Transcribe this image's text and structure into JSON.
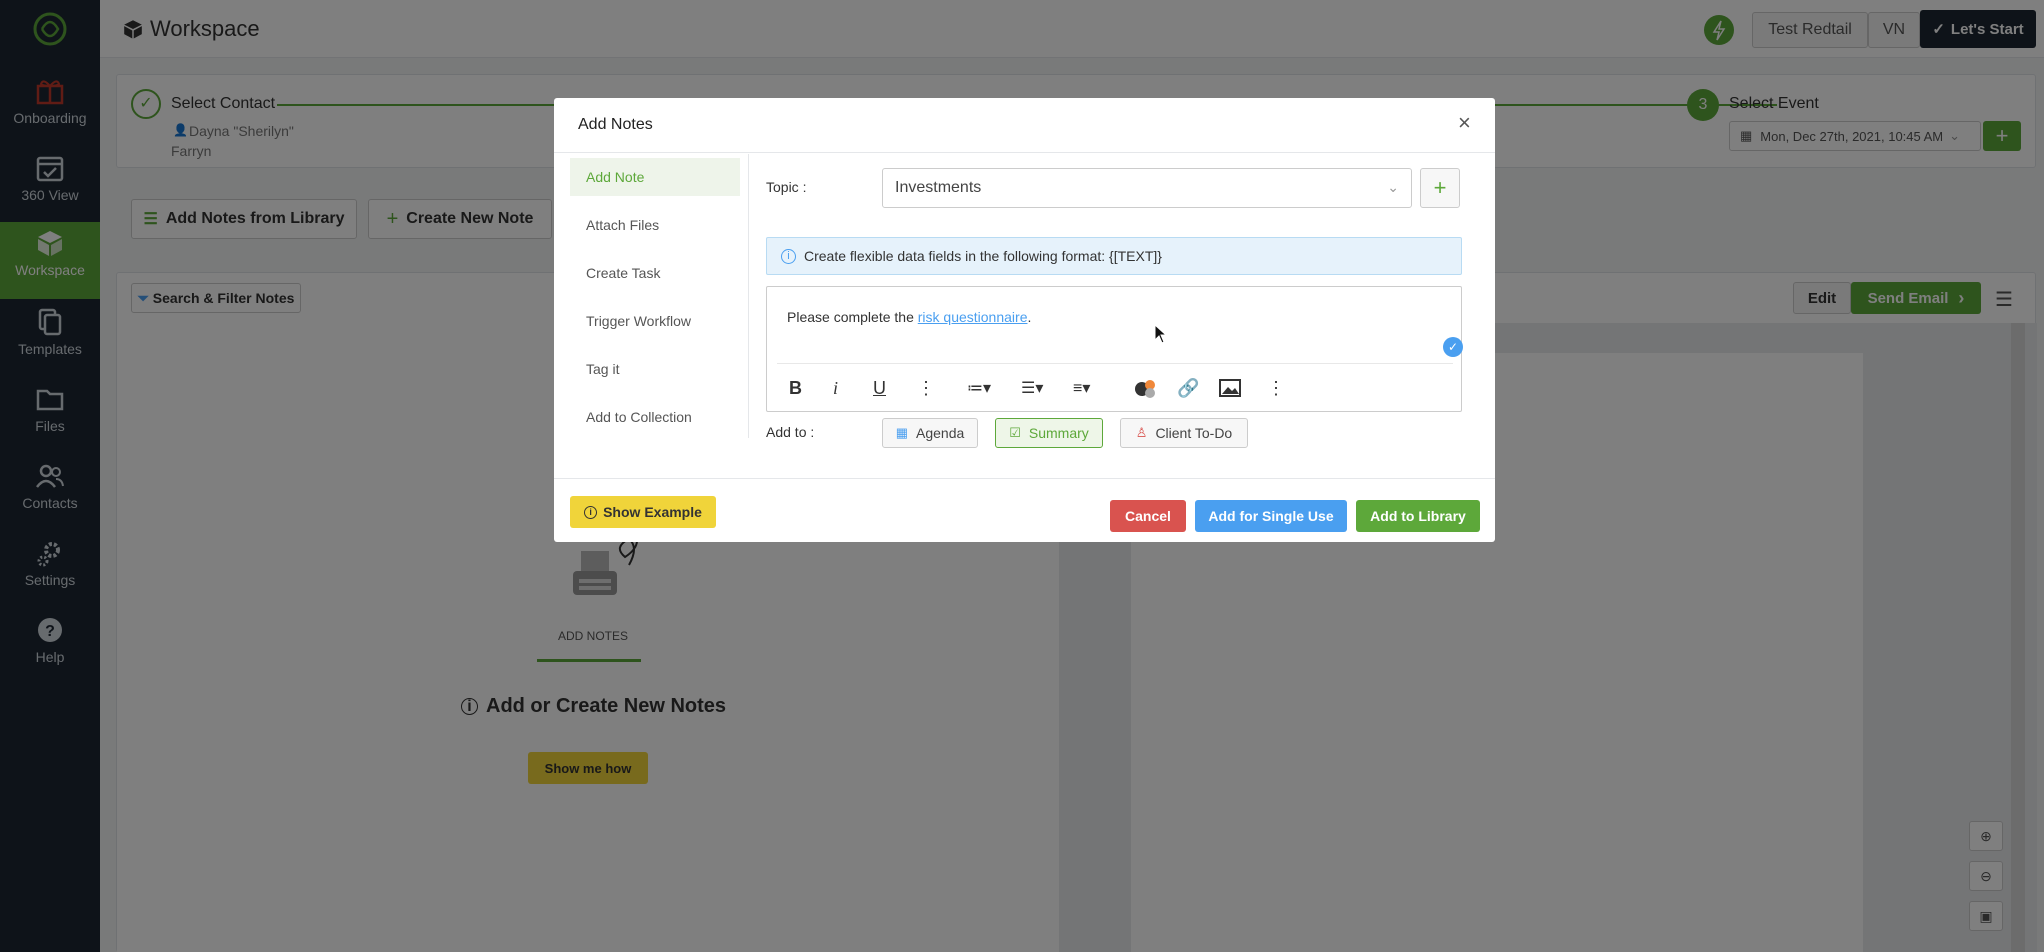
{
  "app": {
    "title": "Workspace"
  },
  "sidebar": {
    "items": [
      {
        "label": "Onboarding",
        "icon": "gift-icon"
      },
      {
        "label": "360 View",
        "icon": "calendar-check-icon"
      },
      {
        "label": "Workspace",
        "icon": "cube-icon"
      },
      {
        "label": "Templates",
        "icon": "documents-icon"
      },
      {
        "label": "Files",
        "icon": "folder-icon"
      },
      {
        "label": "Contacts",
        "icon": "users-icon"
      },
      {
        "label": "Settings",
        "icon": "gears-icon"
      },
      {
        "label": "Help",
        "icon": "help-circle-icon"
      }
    ]
  },
  "header": {
    "account": "Test Redtail",
    "initials": "VN",
    "start_label": "Let's Start"
  },
  "steps": {
    "contact_title": "Select Contact",
    "contact_name_line1": "Dayna \"Sherilyn\"",
    "contact_name_line2": "Farryn",
    "event_number": "3",
    "event_title": "Select Event",
    "event_date": "Mon, Dec 27th, 2021, 10:45 AM"
  },
  "toolbar": {
    "add_from_library": "Add Notes from Library",
    "create_new": "Create New Note",
    "search_filter": "Search & Filter Notes",
    "edit": "Edit",
    "send_email": "Send Email"
  },
  "empty": {
    "caption": "ADD NOTES",
    "title": "Add or Create New Notes",
    "show_me": "Show me how"
  },
  "modal": {
    "title": "Add Notes",
    "menu": [
      "Add Note",
      "Attach Files",
      "Create Task",
      "Trigger Workflow",
      "Tag it",
      "Add to Collection"
    ],
    "topic_label": "Topic :",
    "topic_value": "Investments",
    "info": "Create flexible data fields in the following format: {[TEXT]}",
    "editor_prefix": "Please complete the ",
    "editor_link": "risk questionnaire",
    "editor_suffix": ".",
    "add_to_label": "Add to :",
    "add_to": [
      "Agenda",
      "Summary",
      "Client To-Do"
    ],
    "show_example": "Show Example",
    "cancel": "Cancel",
    "single_use": "Add for Single Use",
    "add_library": "Add to Library"
  },
  "colors": {
    "green": "#5da83a",
    "blue": "#4a9ff0",
    "red": "#d9534f",
    "yellow": "#f0d43a",
    "sidebar": "#1d2733"
  }
}
